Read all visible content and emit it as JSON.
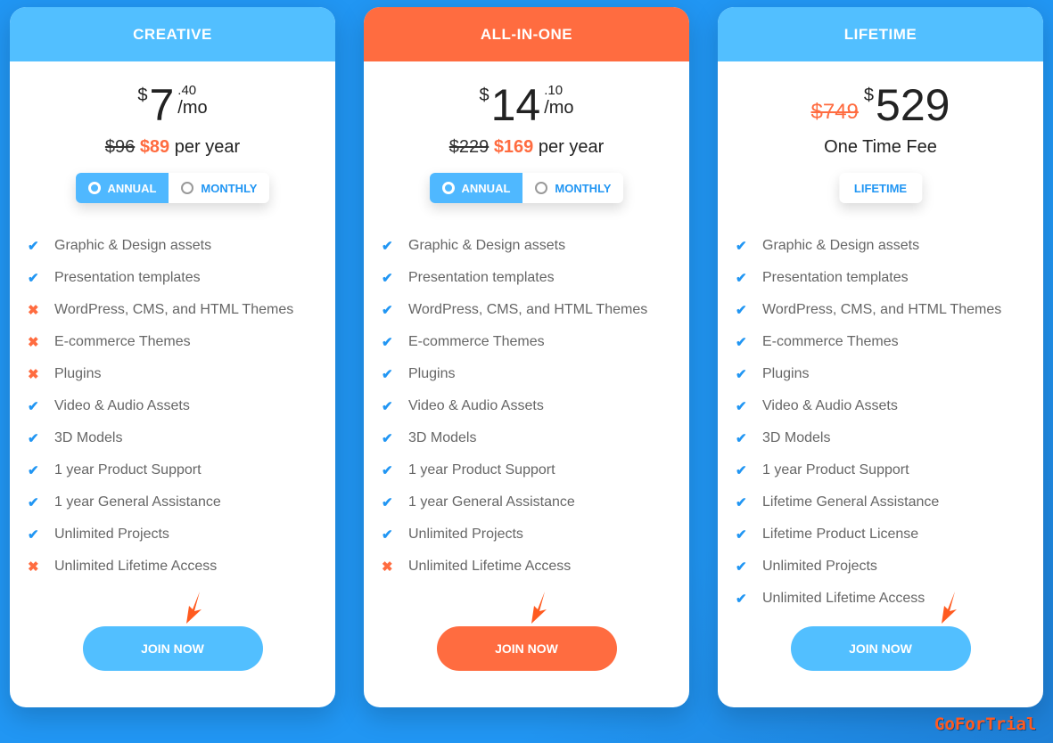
{
  "plans": [
    {
      "name": "CREATIVE",
      "price": {
        "currency": "$",
        "whole": "7",
        "cents": ".40",
        "period": "/mo"
      },
      "yearly": {
        "old": "$96",
        "new": "$89",
        "suffix": "per year"
      },
      "toggle": {
        "annual": "ANNUAL",
        "monthly": "MONTHLY",
        "selected": "annual"
      },
      "features": [
        {
          "label": "Graphic & Design assets",
          "included": true
        },
        {
          "label": "Presentation templates",
          "included": true
        },
        {
          "label": "WordPress, CMS, and HTML Themes",
          "included": false
        },
        {
          "label": "E-commerce Themes",
          "included": false
        },
        {
          "label": "Plugins",
          "included": false
        },
        {
          "label": "Video & Audio Assets",
          "included": true
        },
        {
          "label": "3D Models",
          "included": true
        },
        {
          "label": "1 year Product Support",
          "included": true
        },
        {
          "label": "1 year General Assistance",
          "included": true
        },
        {
          "label": "Unlimited Projects",
          "included": true
        },
        {
          "label": "Unlimited Lifetime Access",
          "included": false
        }
      ],
      "cta": "JOIN NOW"
    },
    {
      "name": "ALL-IN-ONE",
      "price": {
        "currency": "$",
        "whole": "14",
        "cents": ".10",
        "period": "/mo"
      },
      "yearly": {
        "old": "$229",
        "new": "$169",
        "suffix": "per year"
      },
      "toggle": {
        "annual": "ANNUAL",
        "monthly": "MONTHLY",
        "selected": "annual"
      },
      "features": [
        {
          "label": "Graphic & Design assets",
          "included": true
        },
        {
          "label": "Presentation templates",
          "included": true
        },
        {
          "label": "WordPress, CMS, and HTML Themes",
          "included": true
        },
        {
          "label": "E-commerce Themes",
          "included": true
        },
        {
          "label": "Plugins",
          "included": true
        },
        {
          "label": "Video & Audio Assets",
          "included": true
        },
        {
          "label": "3D Models",
          "included": true
        },
        {
          "label": "1 year Product Support",
          "included": true
        },
        {
          "label": "1 year General Assistance",
          "included": true
        },
        {
          "label": "Unlimited Projects",
          "included": true
        },
        {
          "label": "Unlimited Lifetime Access",
          "included": false
        }
      ],
      "cta": "JOIN NOW"
    },
    {
      "name": "LIFETIME",
      "price": {
        "old": "$749",
        "currency": "$",
        "whole": "529"
      },
      "subtitle": "One Time Fee",
      "toggle": {
        "single": "LIFETIME"
      },
      "features": [
        {
          "label": "Graphic & Design assets",
          "included": true
        },
        {
          "label": "Presentation templates",
          "included": true
        },
        {
          "label": "WordPress, CMS, and HTML Themes",
          "included": true
        },
        {
          "label": "E-commerce Themes",
          "included": true
        },
        {
          "label": "Plugins",
          "included": true
        },
        {
          "label": "Video & Audio Assets",
          "included": true
        },
        {
          "label": "3D Models",
          "included": true
        },
        {
          "label": "1 year Product Support",
          "included": true
        },
        {
          "label": "Lifetime General Assistance",
          "included": true
        },
        {
          "label": "Lifetime Product License",
          "included": true
        },
        {
          "label": "Unlimited Projects",
          "included": true
        },
        {
          "label": "Unlimited Lifetime Access",
          "included": true
        }
      ],
      "cta": "JOIN NOW"
    }
  ],
  "icons": {
    "check": "✔",
    "cross": "✖"
  },
  "colors": {
    "primary": "#52bfff",
    "accent": "#ff6c40",
    "background": "#2196f3"
  },
  "watermark": "GoForTrial"
}
